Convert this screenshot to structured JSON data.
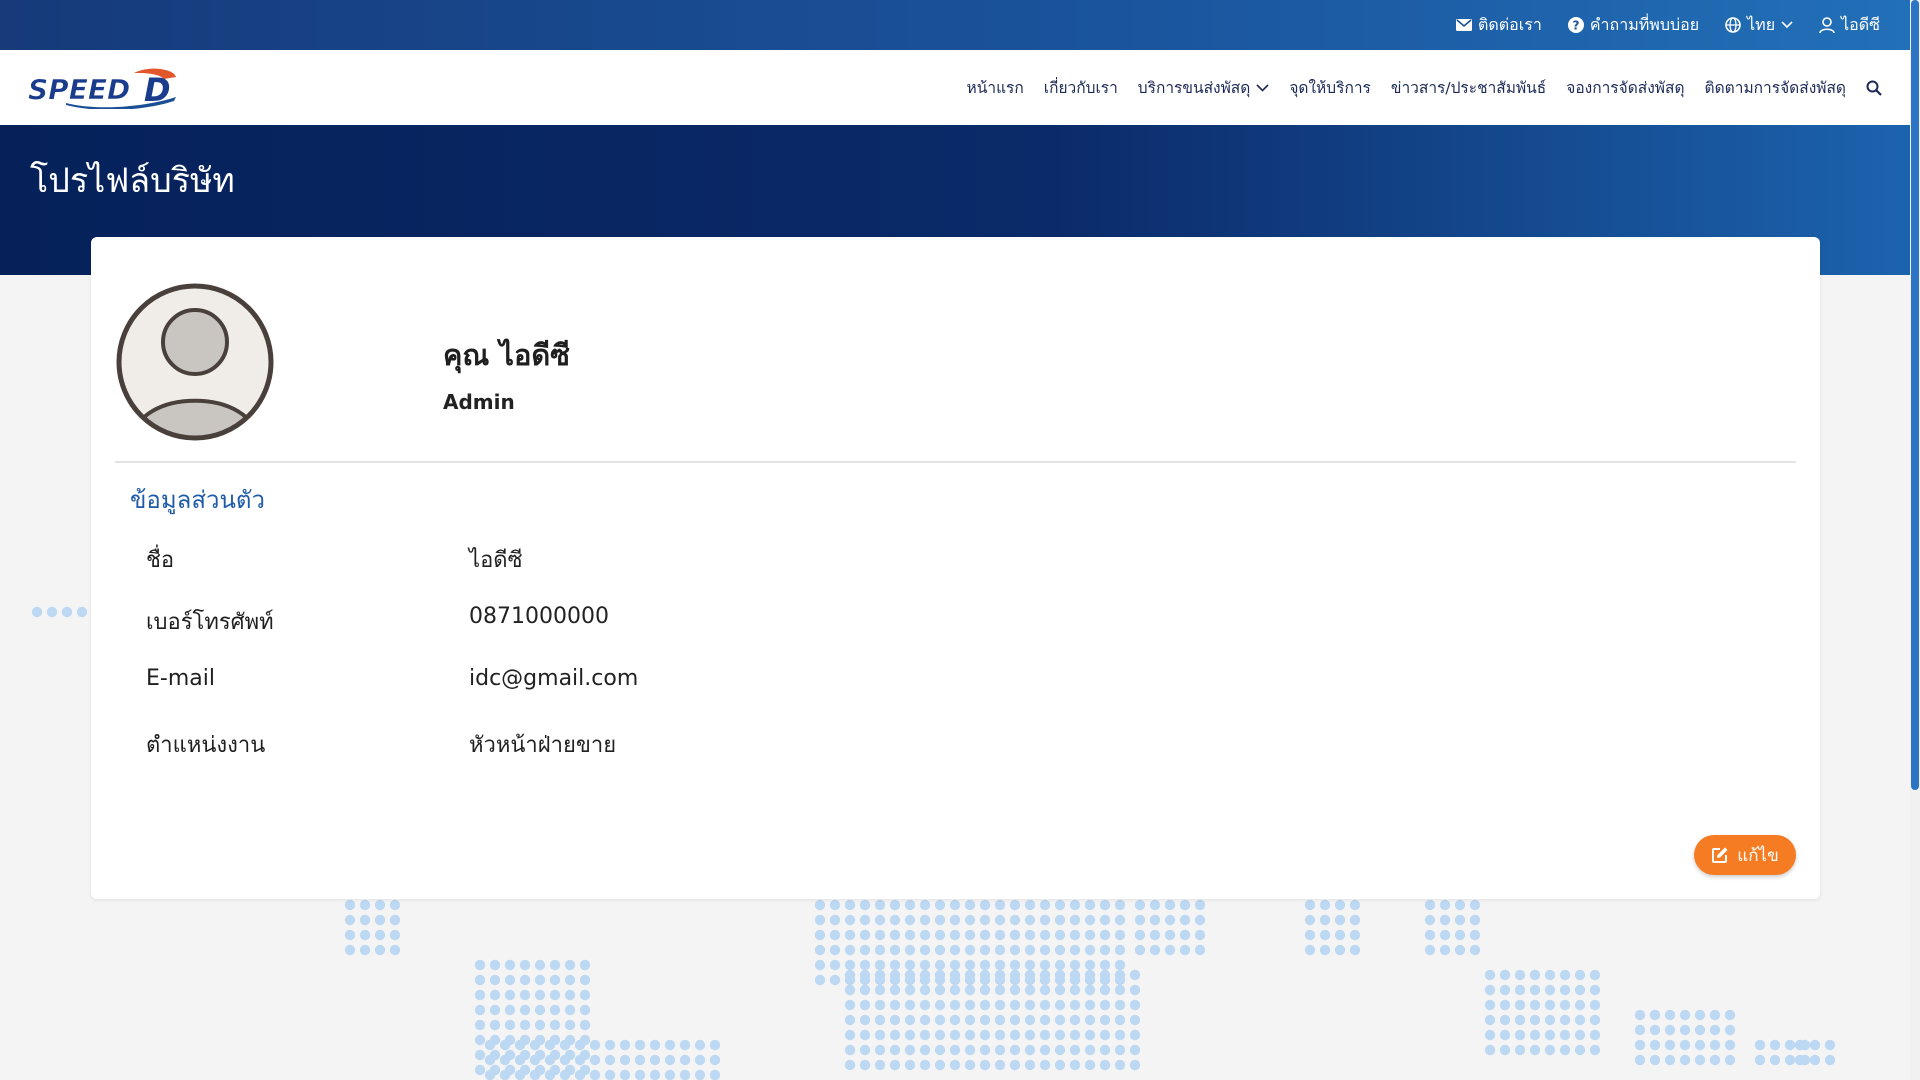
{
  "topbar": {
    "contact": "ติดต่อเรา",
    "faq": "คำถามที่พบบ่อย",
    "language": "ไทย",
    "user": "ไอดีซี"
  },
  "brand": {
    "logo_text": "SPEED-D"
  },
  "nav": {
    "items": [
      "หน้าแรก",
      "เกี่ยวกับเรา",
      "บริการขนส่งพัสดุ",
      "จุดให้บริการ",
      "ข่าวสาร/ประชาสัมพันธ์",
      "จองการจัดส่งพัสดุ",
      "ติดตามการจัดส่งพัสดุ"
    ]
  },
  "page": {
    "title": "โปรไฟล์บริษัท"
  },
  "profile": {
    "name": "คุณ ไอดีซี",
    "role": "Admin",
    "section_title": "ข้อมูลส่วนตัว",
    "fields": [
      {
        "label": "ชื่อ",
        "value": "ไอดีซี"
      },
      {
        "label": "เบอร์โทรศัพท์",
        "value": "0871000000"
      },
      {
        "label": "E-mail",
        "value": "idc@gmail.com"
      },
      {
        "label": "ตำแหน่งงาน",
        "value": "หัวหน้าฝ่ายขาย"
      }
    ],
    "edit_label": "แก้ไข"
  },
  "colors": {
    "topbar": "#1a4f96",
    "hero": "#0b2a69",
    "accent_orange": "#f57c22",
    "section_blue": "#1f5ba8"
  },
  "icons": [
    "envelope-icon",
    "question-circle-icon",
    "globe-icon",
    "chevron-down-icon",
    "user-icon",
    "search-icon",
    "edit-icon",
    "avatar-placeholder"
  ]
}
